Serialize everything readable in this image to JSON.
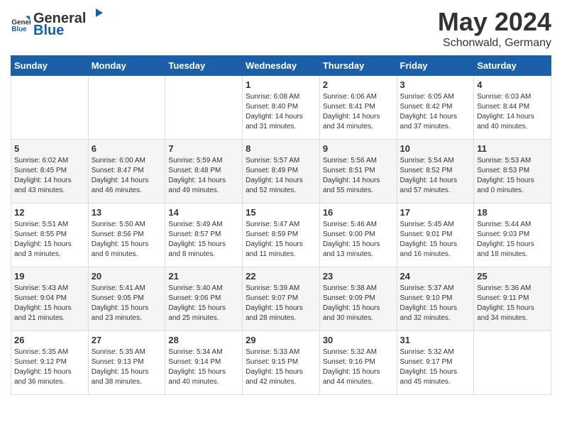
{
  "header": {
    "logo_general": "General",
    "logo_blue": "Blue",
    "month_title": "May 2024",
    "location": "Schonwald, Germany"
  },
  "days_of_week": [
    "Sunday",
    "Monday",
    "Tuesday",
    "Wednesday",
    "Thursday",
    "Friday",
    "Saturday"
  ],
  "weeks": [
    [
      {
        "day": "",
        "info": ""
      },
      {
        "day": "",
        "info": ""
      },
      {
        "day": "",
        "info": ""
      },
      {
        "day": "1",
        "info": "Sunrise: 6:08 AM\nSunset: 8:40 PM\nDaylight: 14 hours and 31 minutes."
      },
      {
        "day": "2",
        "info": "Sunrise: 6:06 AM\nSunset: 8:41 PM\nDaylight: 14 hours and 34 minutes."
      },
      {
        "day": "3",
        "info": "Sunrise: 6:05 AM\nSunset: 8:42 PM\nDaylight: 14 hours and 37 minutes."
      },
      {
        "day": "4",
        "info": "Sunrise: 6:03 AM\nSunset: 8:44 PM\nDaylight: 14 hours and 40 minutes."
      }
    ],
    [
      {
        "day": "5",
        "info": "Sunrise: 6:02 AM\nSunset: 8:45 PM\nDaylight: 14 hours and 43 minutes."
      },
      {
        "day": "6",
        "info": "Sunrise: 6:00 AM\nSunset: 8:47 PM\nDaylight: 14 hours and 46 minutes."
      },
      {
        "day": "7",
        "info": "Sunrise: 5:59 AM\nSunset: 8:48 PM\nDaylight: 14 hours and 49 minutes."
      },
      {
        "day": "8",
        "info": "Sunrise: 5:57 AM\nSunset: 8:49 PM\nDaylight: 14 hours and 52 minutes."
      },
      {
        "day": "9",
        "info": "Sunrise: 5:56 AM\nSunset: 8:51 PM\nDaylight: 14 hours and 55 minutes."
      },
      {
        "day": "10",
        "info": "Sunrise: 5:54 AM\nSunset: 8:52 PM\nDaylight: 14 hours and 57 minutes."
      },
      {
        "day": "11",
        "info": "Sunrise: 5:53 AM\nSunset: 8:53 PM\nDaylight: 15 hours and 0 minutes."
      }
    ],
    [
      {
        "day": "12",
        "info": "Sunrise: 5:51 AM\nSunset: 8:55 PM\nDaylight: 15 hours and 3 minutes."
      },
      {
        "day": "13",
        "info": "Sunrise: 5:50 AM\nSunset: 8:56 PM\nDaylight: 15 hours and 6 minutes."
      },
      {
        "day": "14",
        "info": "Sunrise: 5:49 AM\nSunset: 8:57 PM\nDaylight: 15 hours and 8 minutes."
      },
      {
        "day": "15",
        "info": "Sunrise: 5:47 AM\nSunset: 8:59 PM\nDaylight: 15 hours and 11 minutes."
      },
      {
        "day": "16",
        "info": "Sunrise: 5:46 AM\nSunset: 9:00 PM\nDaylight: 15 hours and 13 minutes."
      },
      {
        "day": "17",
        "info": "Sunrise: 5:45 AM\nSunset: 9:01 PM\nDaylight: 15 hours and 16 minutes."
      },
      {
        "day": "18",
        "info": "Sunrise: 5:44 AM\nSunset: 9:03 PM\nDaylight: 15 hours and 18 minutes."
      }
    ],
    [
      {
        "day": "19",
        "info": "Sunrise: 5:43 AM\nSunset: 9:04 PM\nDaylight: 15 hours and 21 minutes."
      },
      {
        "day": "20",
        "info": "Sunrise: 5:41 AM\nSunset: 9:05 PM\nDaylight: 15 hours and 23 minutes."
      },
      {
        "day": "21",
        "info": "Sunrise: 5:40 AM\nSunset: 9:06 PM\nDaylight: 15 hours and 25 minutes."
      },
      {
        "day": "22",
        "info": "Sunrise: 5:39 AM\nSunset: 9:07 PM\nDaylight: 15 hours and 28 minutes."
      },
      {
        "day": "23",
        "info": "Sunrise: 5:38 AM\nSunset: 9:09 PM\nDaylight: 15 hours and 30 minutes."
      },
      {
        "day": "24",
        "info": "Sunrise: 5:37 AM\nSunset: 9:10 PM\nDaylight: 15 hours and 32 minutes."
      },
      {
        "day": "25",
        "info": "Sunrise: 5:36 AM\nSunset: 9:11 PM\nDaylight: 15 hours and 34 minutes."
      }
    ],
    [
      {
        "day": "26",
        "info": "Sunrise: 5:35 AM\nSunset: 9:12 PM\nDaylight: 15 hours and 36 minutes."
      },
      {
        "day": "27",
        "info": "Sunrise: 5:35 AM\nSunset: 9:13 PM\nDaylight: 15 hours and 38 minutes."
      },
      {
        "day": "28",
        "info": "Sunrise: 5:34 AM\nSunset: 9:14 PM\nDaylight: 15 hours and 40 minutes."
      },
      {
        "day": "29",
        "info": "Sunrise: 5:33 AM\nSunset: 9:15 PM\nDaylight: 15 hours and 42 minutes."
      },
      {
        "day": "30",
        "info": "Sunrise: 5:32 AM\nSunset: 9:16 PM\nDaylight: 15 hours and 44 minutes."
      },
      {
        "day": "31",
        "info": "Sunrise: 5:32 AM\nSunset: 9:17 PM\nDaylight: 15 hours and 45 minutes."
      },
      {
        "day": "",
        "info": ""
      }
    ]
  ]
}
